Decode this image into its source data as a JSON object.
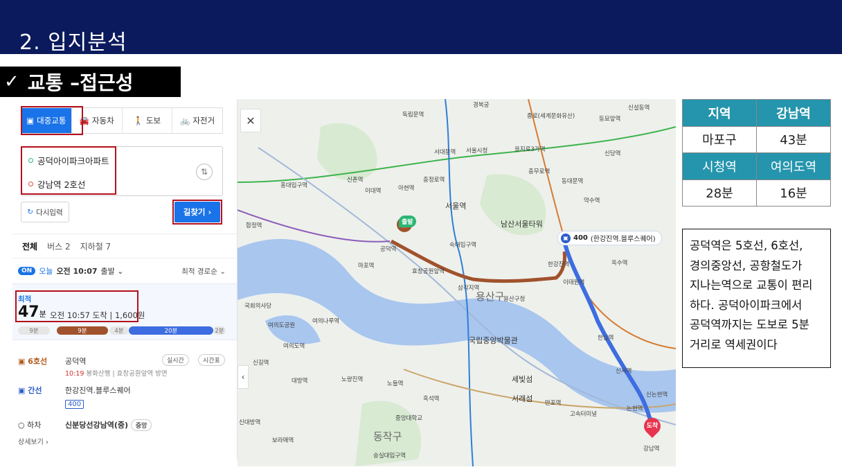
{
  "header": {
    "title": "2. 입지분석"
  },
  "section": {
    "check_glyph": "✓",
    "title": "교통 –접근성"
  },
  "route_panel": {
    "modes": [
      {
        "label": "대중교통",
        "icon": "bus-icon"
      },
      {
        "label": "자동차",
        "icon": "car-icon"
      },
      {
        "label": "도보",
        "icon": "walk-icon"
      },
      {
        "label": "자전거",
        "icon": "bike-icon"
      }
    ],
    "origin": "공덕아이파크아파트",
    "destination": "강남역 2호선",
    "swap_glyph": "⇅",
    "reset_label": "다시입력",
    "search_label": "길찾기 ›",
    "tabs": [
      "전체",
      "버스 2",
      "지하철 7"
    ],
    "depart": {
      "on": "ON",
      "today": "오늘",
      "time": "오전 10:07",
      "suffix": "출발 ⌄",
      "sort": "최적 경로순 ⌄"
    },
    "best": {
      "label": "최적",
      "minutes": "47",
      "min_unit": "분",
      "arrive": "오전 10:57 도착 | 1,600원",
      "segments": [
        "9분",
        "9분",
        "4분",
        "20분",
        "2분"
      ]
    },
    "steps": {
      "s1_line": "6호선",
      "s1_station": "공덕역",
      "s1_time": "10:19",
      "s1_info": "봉화산행 | 효창공원앞역 방면",
      "s1_btn1": "실시간",
      "s1_btn2": "시간표",
      "s2_line": "간선",
      "s2_station": "한강진역.블루스퀘어",
      "s2_bus": "400",
      "s3_line": "하차",
      "s3_station": "신분당선강남역(중)",
      "s3_badge": "중앙",
      "more": "상세보기 ›"
    }
  },
  "map": {
    "close_glyph": "✕",
    "collapse_glyph": "‹",
    "start_label": "출발",
    "end_label": "도착",
    "bus_tag": "400",
    "bus_tag_rest": "(한강진역.블루스퀘어)",
    "districts": [
      "용산구",
      "동작구"
    ],
    "labels": [
      "경복궁",
      "독립문역",
      "종로(세계문화유산)",
      "동묘앞역",
      "신설동역",
      "을지로3가역",
      "충무로역",
      "동대문역",
      "신당역",
      "서울역",
      "남산서울타워",
      "약수역",
      "옥수역",
      "한강진역",
      "공덕역",
      "효창공원앞역",
      "삼각지역",
      "이태원역",
      "한남역",
      "신사역",
      "논현역",
      "신논현역",
      "강남역",
      "여의도역",
      "여의나루역",
      "신길역",
      "대방역",
      "노량진역",
      "노들역",
      "흑석역",
      "반포역",
      "고속터미널",
      "서래섬",
      "세빛섬",
      "마포역",
      "합정역",
      "홍대입구역",
      "신촌역",
      "이대역",
      "아현역",
      "충정로역",
      "서대문역",
      "숙대입구역",
      "국립중앙박물관",
      "용산구청",
      "국회의사당",
      "여의도공원",
      "보라매역",
      "신대방역",
      "숭실대입구역",
      "중앙대학교",
      "서울시청"
    ]
  },
  "table": {
    "h1": "지역",
    "h2": "강남역",
    "r1a": "마포구",
    "r1b": "43분",
    "h3": "시청역",
    "h4": "여의도역",
    "r2a": "28분",
    "r2b": "16분"
  },
  "note": {
    "lines": [
      "공덕역은 5호선, 6호선,",
      "경의중앙선, 공항철도가",
      "지나는역으로 교통이 편리",
      "하다. 공덕아이파크에서",
      "공덕역까지는 도보로 5분",
      "거리로 역세권이다"
    ]
  },
  "colors": {
    "header": "#0b1a5c",
    "accent": "#1a73e8",
    "highlight": "#b40f1c",
    "table_head": "#2595ad",
    "line6": "#a0522d",
    "bus": "#3d6de0"
  }
}
